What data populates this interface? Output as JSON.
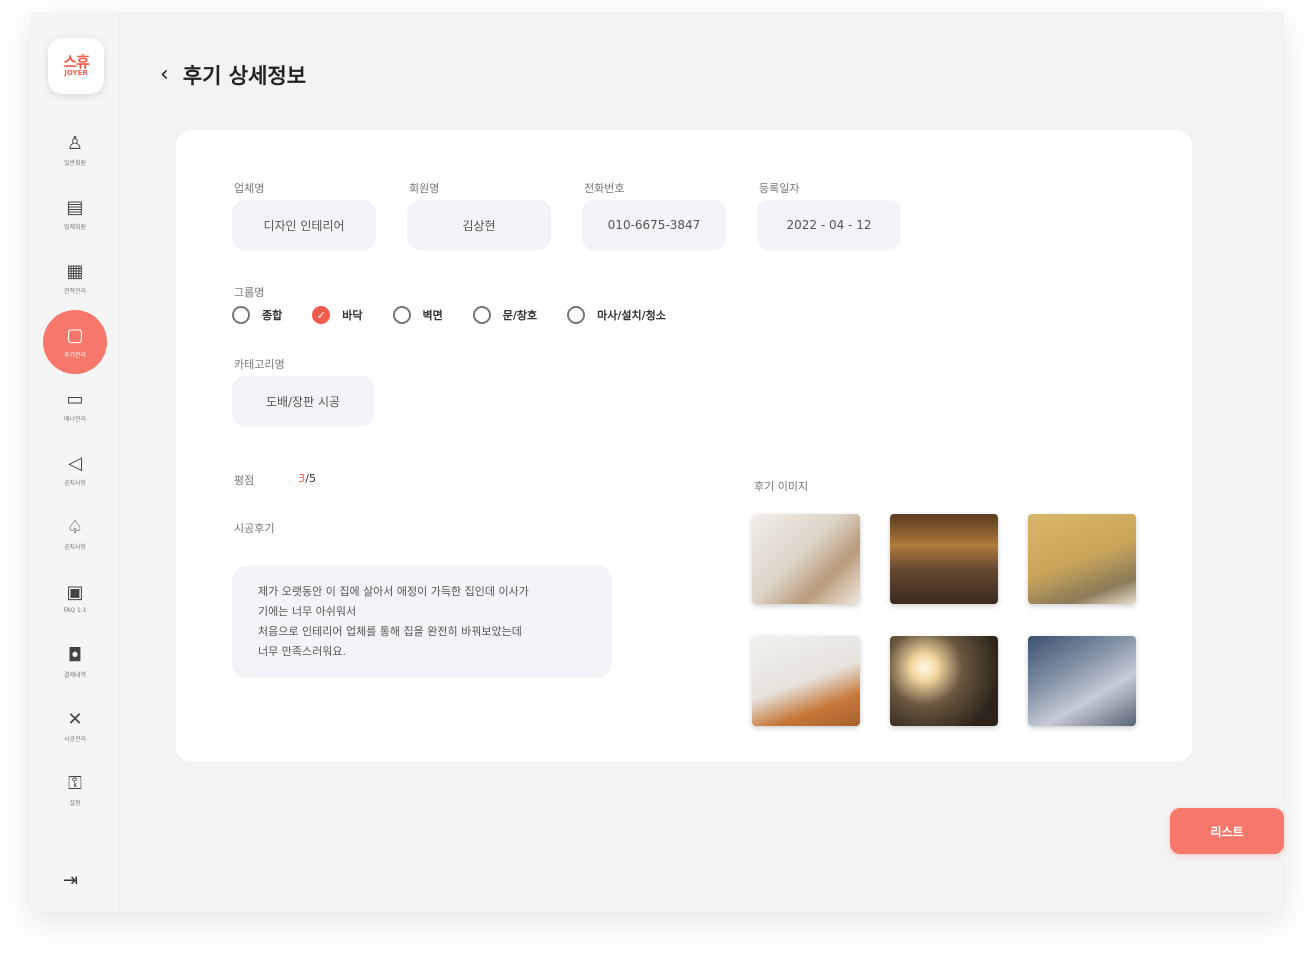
{
  "logo": {
    "mark": "스휴",
    "sub": "JOYER"
  },
  "sidebar": {
    "items": [
      {
        "icon": "user-icon",
        "glyph": "♙",
        "label": "일반회원"
      },
      {
        "icon": "building-icon",
        "glyph": "▤",
        "label": "업체회원"
      },
      {
        "icon": "document-icon",
        "glyph": "▦",
        "label": "견적관리"
      },
      {
        "icon": "review-icon",
        "glyph": "▢",
        "label": "후기관리"
      },
      {
        "icon": "monitor-icon",
        "glyph": "▭",
        "label": "배너관리"
      },
      {
        "icon": "megaphone-icon",
        "glyph": "◁",
        "label": "공지사항"
      },
      {
        "icon": "thumbs-up-icon",
        "glyph": "♤",
        "label": "공지사항"
      },
      {
        "icon": "chat-icon",
        "glyph": "▣",
        "label": "FAQ 1:1"
      },
      {
        "icon": "bag-icon",
        "glyph": "◘",
        "label": "결제내역"
      },
      {
        "icon": "tools-icon",
        "glyph": "✕",
        "label": "시공관리"
      },
      {
        "icon": "lock-icon",
        "glyph": "⚿",
        "label": "설정"
      }
    ],
    "active_index": 3,
    "logout_glyph": "⇥"
  },
  "header": {
    "back_glyph": "‹",
    "title": "후기 상세정보"
  },
  "fields": [
    {
      "label": "업체명",
      "value": "디자인 인테리어"
    },
    {
      "label": "회원명",
      "value": "김상현"
    },
    {
      "label": "전화번호",
      "value": "010-6675-3847"
    },
    {
      "label": "등록일자",
      "value": "2022 - 04 - 12"
    }
  ],
  "group": {
    "label": "그룹명",
    "options": [
      {
        "label": "종합",
        "checked": false
      },
      {
        "label": "바닥",
        "checked": true
      },
      {
        "label": "벽면",
        "checked": false
      },
      {
        "label": "문/창호",
        "checked": false
      },
      {
        "label": "마사/설치/청소",
        "checked": false
      }
    ]
  },
  "category": {
    "label": "카테고리명",
    "value": "도배/장판 시공"
  },
  "rating": {
    "label": "평점",
    "value_hl": "3",
    "value_rest": "/5"
  },
  "review": {
    "label": "시공후기",
    "lines": [
      "제가 오랫동안 이 집에 살아서 애정이 가득한 집인데 이사가",
      "기에는 너무 아쉬워서",
      "처음으로 인테리어 업체를 통해 집을 완전히 바꿔보았는데",
      "너무 만족스러워요."
    ]
  },
  "photos": {
    "label": "후기 이미지",
    "items": [
      "living-room-photo",
      "dining-room-photo",
      "mustard-room-photo",
      "sofa-room-photo",
      "lamp-photo",
      "bedroom-photo"
    ]
  },
  "list_button": "리스트",
  "colors": {
    "accent": "#f7776a",
    "check": "#f35c4c"
  }
}
